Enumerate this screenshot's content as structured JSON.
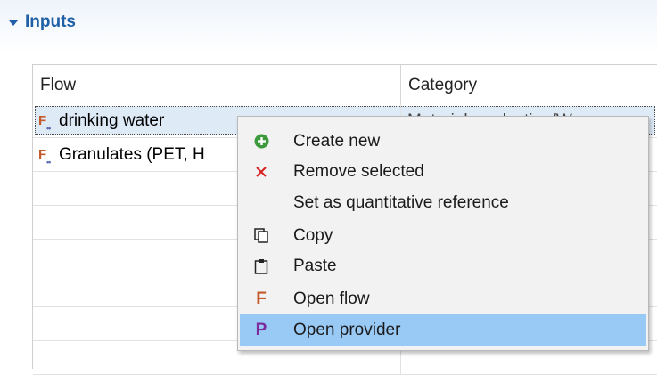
{
  "section": {
    "title": "Inputs"
  },
  "table": {
    "columns": [
      "Flow",
      "Category"
    ],
    "rows": [
      {
        "flow": "drinking water",
        "category": "Material production/W..."
      },
      {
        "flow": "Granulates (PET, H",
        "category": ""
      }
    ]
  },
  "context_menu": {
    "items": [
      {
        "label": "Create new",
        "icon": "plus-circle-icon"
      },
      {
        "label": "Remove selected",
        "icon": "x-icon"
      },
      {
        "label": "Set as quantitative reference",
        "icon": ""
      },
      {
        "label": "Copy",
        "icon": "copy-icon"
      },
      {
        "label": "Paste",
        "icon": "paste-icon"
      },
      {
        "label": "Open flow",
        "icon": "flow-f-icon"
      },
      {
        "label": "Open provider",
        "icon": "provider-p-icon"
      }
    ],
    "hovered": "Open provider"
  },
  "colors": {
    "accent": "#1f5fa6",
    "hover": "#99c9f5",
    "add_green": "#3c9a3c",
    "remove_red": "#d92020",
    "flow_orange": "#c45a2a",
    "provider_purple": "#7a2a9a"
  }
}
